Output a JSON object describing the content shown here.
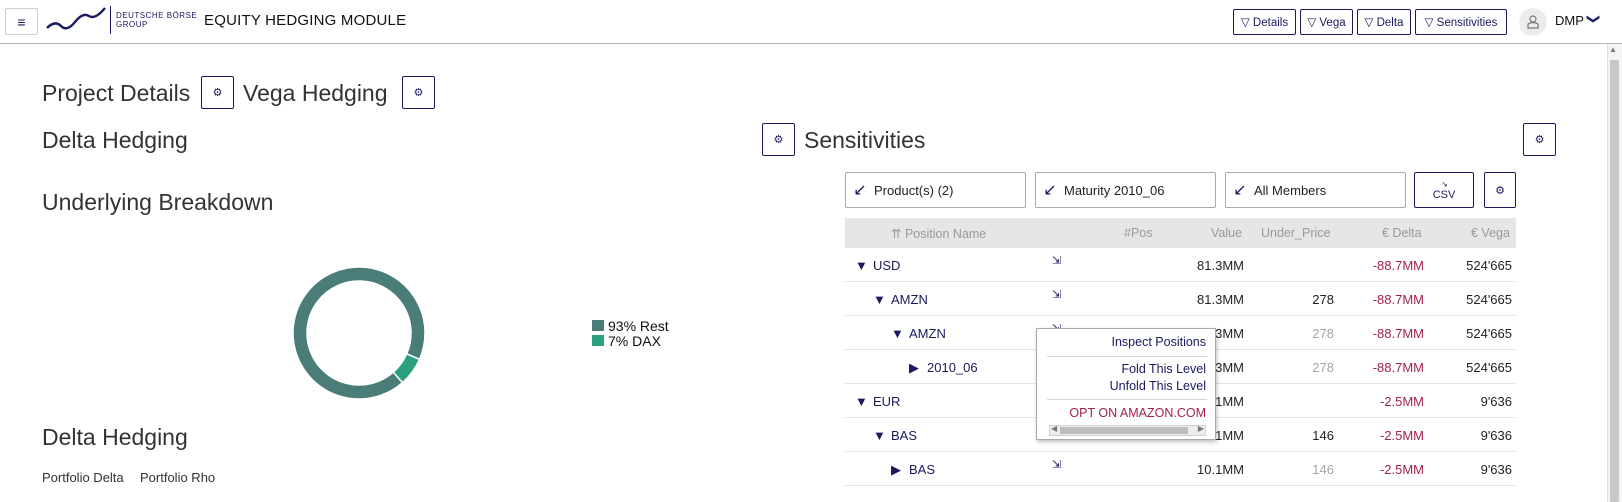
{
  "header": {
    "menu_icon": "hamburger-icon",
    "logo_text_line1": "DEUTSCHE BÖRSE",
    "logo_text_line2": "GROUP",
    "title": "EQUITY HEDGING MODULE",
    "buttons": [
      {
        "label": "▽ Details"
      },
      {
        "label": "▽ Vega"
      },
      {
        "label": "▽ Delta"
      },
      {
        "label": "▽ Sensitivities"
      }
    ],
    "user": "DMP",
    "user_chevron": "❯",
    "brand_color": "#1a1a5e"
  },
  "sections": {
    "project_details": "Project Details",
    "vega_hedging": "Vega Hedging",
    "delta_hedging_top": "Delta Hedging",
    "sensitivities": "Sensitivities",
    "underlying_breakdown": "Underlying Breakdown",
    "delta_hedging_bottom": "Delta Hedging",
    "gear_glyph": "⚙"
  },
  "chart_data": {
    "type": "pie",
    "variant": "donut",
    "categories": [
      "Rest",
      "DAX"
    ],
    "values": [
      93,
      7
    ],
    "colors": [
      "#4a7d78",
      "#2aa080"
    ],
    "legend": [
      "93% Rest",
      "7% DAX"
    ],
    "legend_position": "right"
  },
  "kpis": {
    "portfolio_delta": "Portfolio Delta",
    "portfolio_rho": "Portfolio Rho"
  },
  "filters": {
    "products": "Product(s) (2)",
    "maturity": "Maturity 2010_06",
    "members": "All Members",
    "csv_label": "CSV",
    "arrow_glyph": "↙"
  },
  "table": {
    "columns": {
      "name": "⇈ Position Name",
      "pos": "#Pos",
      "value": "Value",
      "under_price": "Under_Price",
      "delta": "€ Delta",
      "vega": "€ Vega"
    },
    "drill_glyph": "⇲",
    "rows": [
      {
        "toggle": "▼",
        "name": "USD",
        "value": "81.3MM",
        "price": "",
        "delta": "-88.7MM",
        "vega": "524'665"
      },
      {
        "toggle": "▼",
        "name": "AMZN",
        "value": "81.3MM",
        "price": "278",
        "delta": "-88.7MM",
        "vega": "524'665"
      },
      {
        "toggle": "▼",
        "name": "AMZN",
        "value": "3MM",
        "price": "278",
        "delta": "-88.7MM",
        "vega": "524'665"
      },
      {
        "toggle": "▶",
        "name": "2010_06",
        "value": "3MM",
        "price": "278",
        "delta": "-88.7MM",
        "vega": "524'665"
      },
      {
        "toggle": "▼",
        "name": "EUR",
        "value": "1MM",
        "price": "",
        "delta": "-2.5MM",
        "vega": "9'636"
      },
      {
        "toggle": "▼",
        "name": "BAS",
        "value": "1MM",
        "price": "146",
        "delta": "-2.5MM",
        "vega": "9'636"
      },
      {
        "toggle": "▶",
        "name": "BAS",
        "value": "10.1MM",
        "price": "146",
        "delta": "-2.5MM",
        "vega": "9'636"
      }
    ]
  },
  "context_menu": {
    "inspect": "Inspect Positions",
    "fold": "Fold This Level",
    "unfold": "Unfold This Level",
    "opt": "OPT ON AMAZON.COM"
  }
}
